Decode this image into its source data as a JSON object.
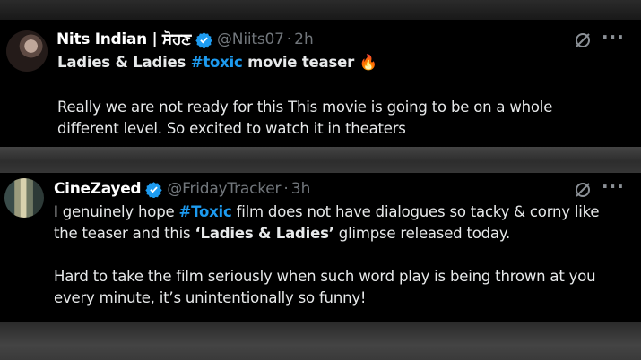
{
  "tweets": [
    {
      "name": "Nits Indian | ਸੋਹਣ",
      "handle": "@Niits07",
      "separator": "·",
      "time": "2h",
      "title_pre": "Ladies & Ladies ",
      "title_hashtag": "#toxic",
      "title_post": " movie teaser ",
      "title_emoji": "🔥",
      "body_line1": "Really we are not ready for this This movie is going to be on a whole",
      "body_line2": "different level. So excited to watch it in theaters"
    },
    {
      "name": "CineZayed",
      "handle": "@FridayTracker",
      "separator": "·",
      "time": "3h",
      "l1_pre": "I genuinely hope ",
      "l1_hashtag": "#Toxic",
      "l1_post": " film does not have dialogues so tacky & corny like",
      "l2_pre": "the teaser and this ",
      "l2_bold": "‘Ladies & Ladies’",
      "l2_post": " glimpse released today.",
      "l3": "Hard to take the film seriously when such word play is being thrown at you",
      "l4": "every minute, it’s unintentionally so funny!"
    }
  ],
  "icons": {
    "verified": "verified-badge-icon",
    "grok": "grok-icon",
    "more": "more-icon"
  },
  "colors": {
    "background": "#000000",
    "text": "#e7e9ea",
    "muted": "#71767b",
    "accent": "#1d9bf0"
  }
}
